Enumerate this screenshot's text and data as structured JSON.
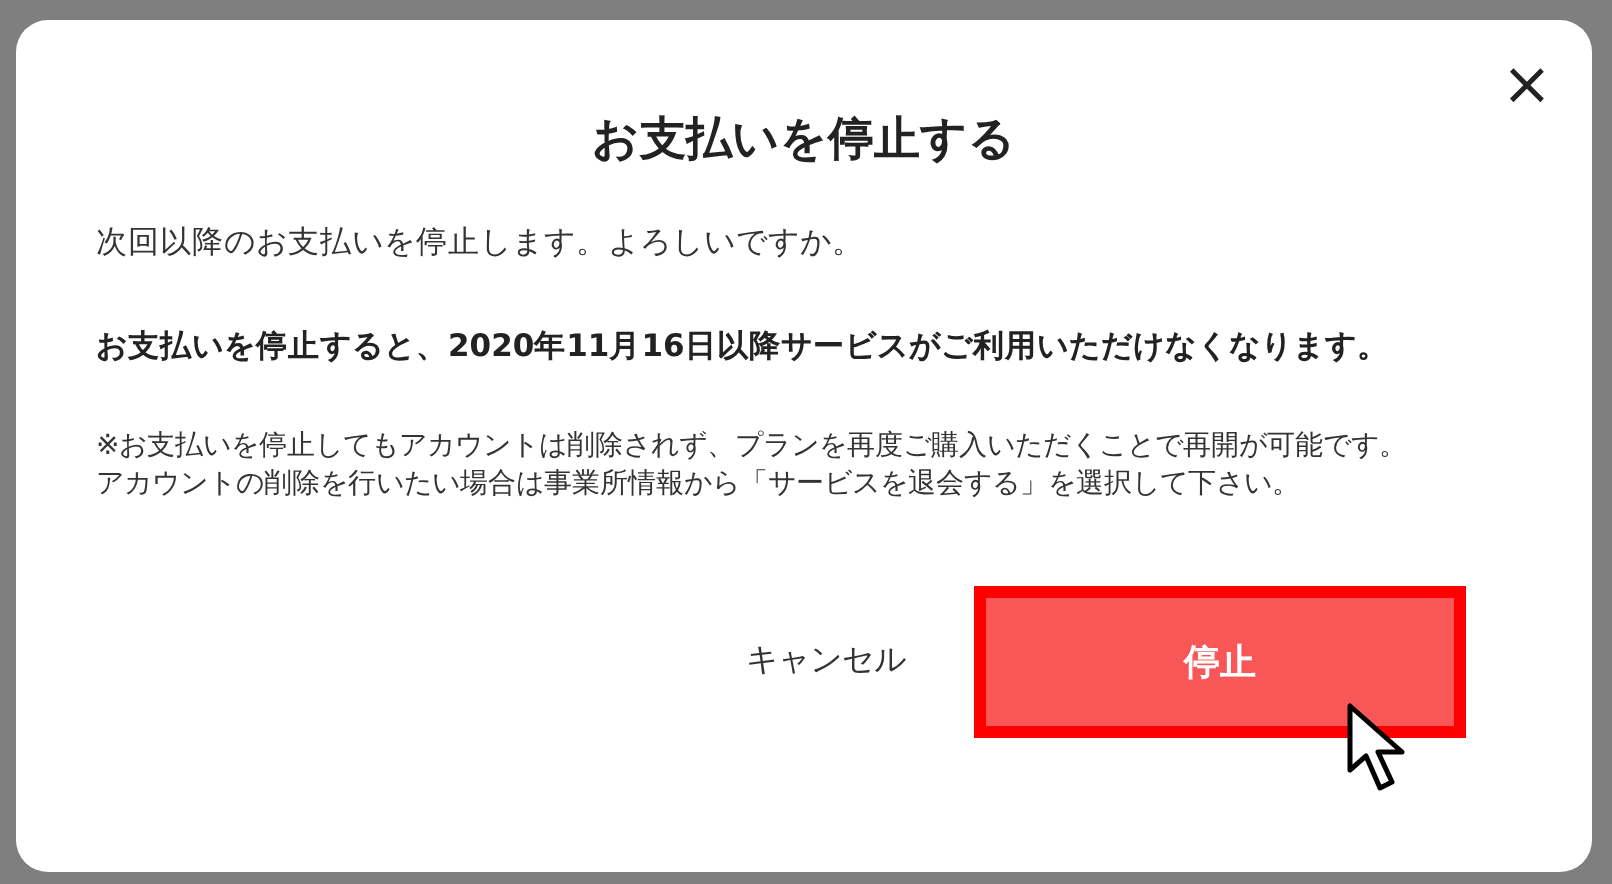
{
  "dialog": {
    "title": "お支払いを停止する",
    "close": "×",
    "paragraphs": [
      {
        "kind": "plain",
        "text": "次回以降のお支払いを停止します。よろしいですか。"
      },
      {
        "kind": "warning",
        "text": "お支払いを停止すると、2020年11月16日以降サービスがご利用いただけなくなります。"
      },
      {
        "kind": "note",
        "text": "※お支払いを停止してもアカウントは削除されず、プランを再度ご購入いただくことで再開が可能です。"
      },
      {
        "kind": "note",
        "text": "アカウントの削除を行いたい場合は事業所情報から「サービスを退会する」を選択して下さい。"
      }
    ],
    "buttons": [
      {
        "kind": "cancel",
        "label": "キャンセル"
      },
      {
        "kind": "primary",
        "label": "停止",
        "highlighted": true
      }
    ]
  }
}
